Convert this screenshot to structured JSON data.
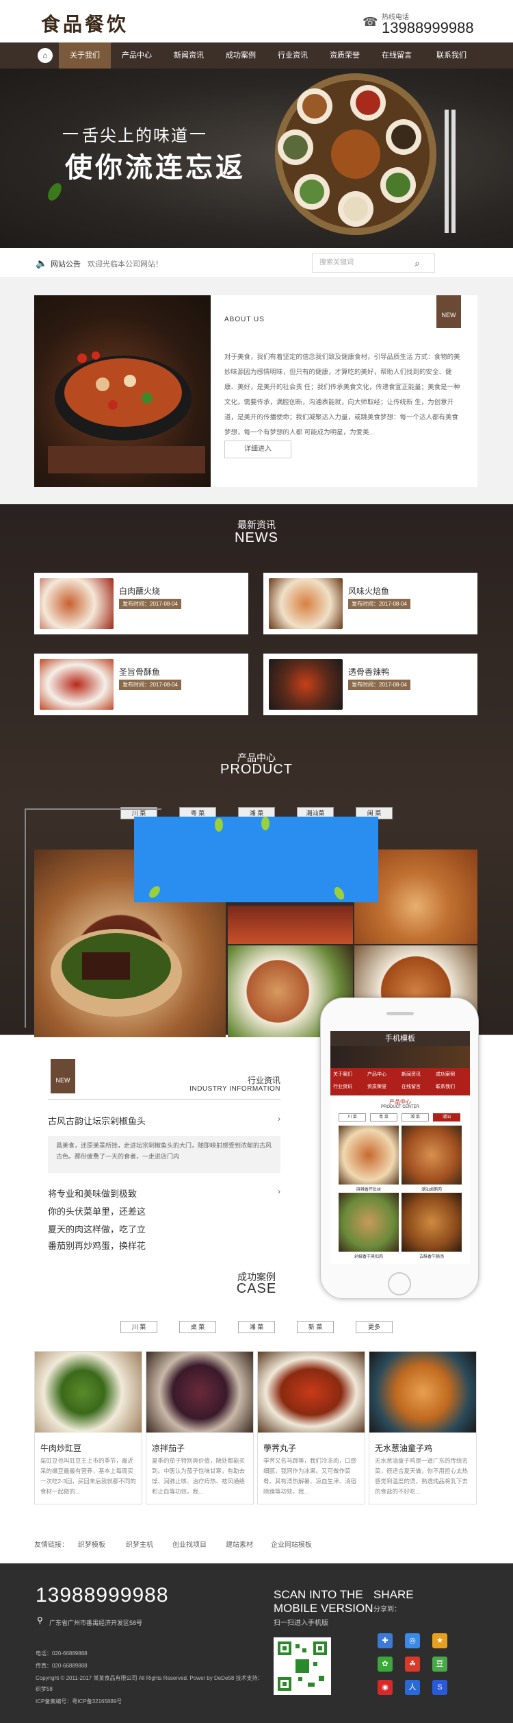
{
  "header": {
    "logo": "食品餐饮",
    "hotline_label": "热线电话",
    "hotline_number": "13988999988"
  },
  "nav": [
    "关于我们",
    "产品中心",
    "新闻资讯",
    "成功案例",
    "行业资讯",
    "资质荣誉",
    "在线留言",
    "联系我们"
  ],
  "banner": {
    "line1": "舌尖上的味道",
    "line2": "使你流连忘返"
  },
  "notice": {
    "label": "网站公告",
    "text": "欢迎光临本公司网站！",
    "search_placeholder": "搜索关键词"
  },
  "about": {
    "title": "ABOUT US",
    "tag": "NEW",
    "body": "对于美食，我们有着坚定的信念我们致及健康食材，引导品质生活 方式：食物的美妙味源因为感情明味，但只有的健康，才算吃的美好，帮助人们找到的安全、健康、美好，是美开的社会责 任；我们传承美食文化，传递食宣正能量；美食是一种文化，需要传承，满腔创新，沟通表能就，向大师取经；让传统新 生，为创意开道，是美开的传播使命；我们凝聚达入力量，或跳美食梦想：每一个达人都有美食梦想，每一个有梦想的人都 可能成为明星，为爱美...",
    "more": "详细进入"
  },
  "news": {
    "title_cn": "最新资讯",
    "title_en": "NEWS",
    "date_prefix": "发布时间：",
    "items": [
      {
        "title": "白肉蘸火烧",
        "date": "2017-08-04"
      },
      {
        "title": "风味火焙鱼",
        "date": "2017-08-04"
      },
      {
        "title": "圣旨骨酥鱼",
        "date": "2017-08-04"
      },
      {
        "title": "透骨香辣鸭",
        "date": "2017-08-04"
      }
    ]
  },
  "product": {
    "title_cn": "产品中心",
    "title_en": "PRODUCT",
    "tabs": [
      "川 菜",
      "粤 菜",
      "湘 菜",
      "潮汕菜",
      "闽 菜"
    ]
  },
  "industry": {
    "tag": "NEW",
    "title_cn": "行业资讯",
    "title_en": "INDUSTRY INFORMATION",
    "first": "古风古韵让坛宗剁椒鱼头",
    "summary": "昌美食，还原美景所挂，走进坛宗剁椒鱼头的大门，随即映射感受到浓郁的古风古色。那份疲惫了一天的食者，一走进店门内",
    "list": [
      "将专业和美味做到极致",
      "你的头伏菜单里，还差这",
      "夏天的肉这样做，吃了立",
      "番茄别再炒鸡蛋，换样花"
    ]
  },
  "mobile": {
    "title": "手机模板",
    "nav": [
      "关于我们",
      "产品中心",
      "新闻资讯",
      "成功案例",
      "行业资讯",
      "资质荣誉",
      "在线留言",
      "联系我们"
    ],
    "sec_cn": "产品中心",
    "sec_en": "PRODUCT CENTER",
    "tabs": [
      "川 菜",
      "粤 菜",
      "湘 菜",
      "潮汕"
    ],
    "items": [
      "麻辣香芹肚丝",
      "潮汕卤鹅肉",
      "剁椒香干蒸扣肉",
      "古酥香牛腩汤"
    ]
  },
  "case": {
    "title_cn": "成功案例",
    "title_en": "CASE",
    "tabs": [
      "川 菜",
      "桌 菜",
      "湘 菜",
      "新 菜",
      "更多"
    ],
    "items": [
      {
        "title": "牛肉炒豇豆",
        "text": "菜豇豆也叫豇豆王上市的季节，最近采的嫩豆最最有营养，基本上每周买一次吃2-3回，买回来后我就都不同的食材一起做的..."
      },
      {
        "title": "凉拌茄子",
        "text": "夏季的茄子特别爽价值，随处都能买到。中医认为茄子性味甘寒，有助去燥、润肺止咳、治疗痔热、祛风通络和止血等功效。我..."
      },
      {
        "title": "荸荠丸子",
        "text": "荸荠又名马蹄等，我们冷冻肉，口感细腻，我同作为冰果。又可做作菜肴。其有清热解暑、凉血生津、消宿除躁等功效。我..."
      },
      {
        "title": "无水葱油童子鸡",
        "text": "无水葱油童子鸡是一道广东的传统名菜，很适合夏天做，你不用担心太热感觉到温度的烫，熟透炖品将乳下去的食盐的不好吃..."
      }
    ]
  },
  "links": {
    "label": "友情链接：",
    "items": [
      "织梦模板",
      "织梦主机",
      "创业找项目",
      "建站素材",
      "企业网站模板"
    ]
  },
  "footer": {
    "phone": "13988999988",
    "address": "广东省广州市番禺经济开发区58号",
    "tel": "电话：020-66889888",
    "fax": "传真：020-66889888",
    "copyright": "Copyright © 2011-2017 某某食品有限公司 All Rights Reserved. Power by DeDe58 技术支持：",
    "copyright2": "织梦58",
    "icp": "ICP备案编号：粤ICP备32165889号",
    "scan1": "SCAN INTO THE",
    "scan2": "MOBILE VERSION",
    "scan3": "扫一扫进入手机版",
    "share1": "SHARE",
    "share2": "分享到："
  }
}
